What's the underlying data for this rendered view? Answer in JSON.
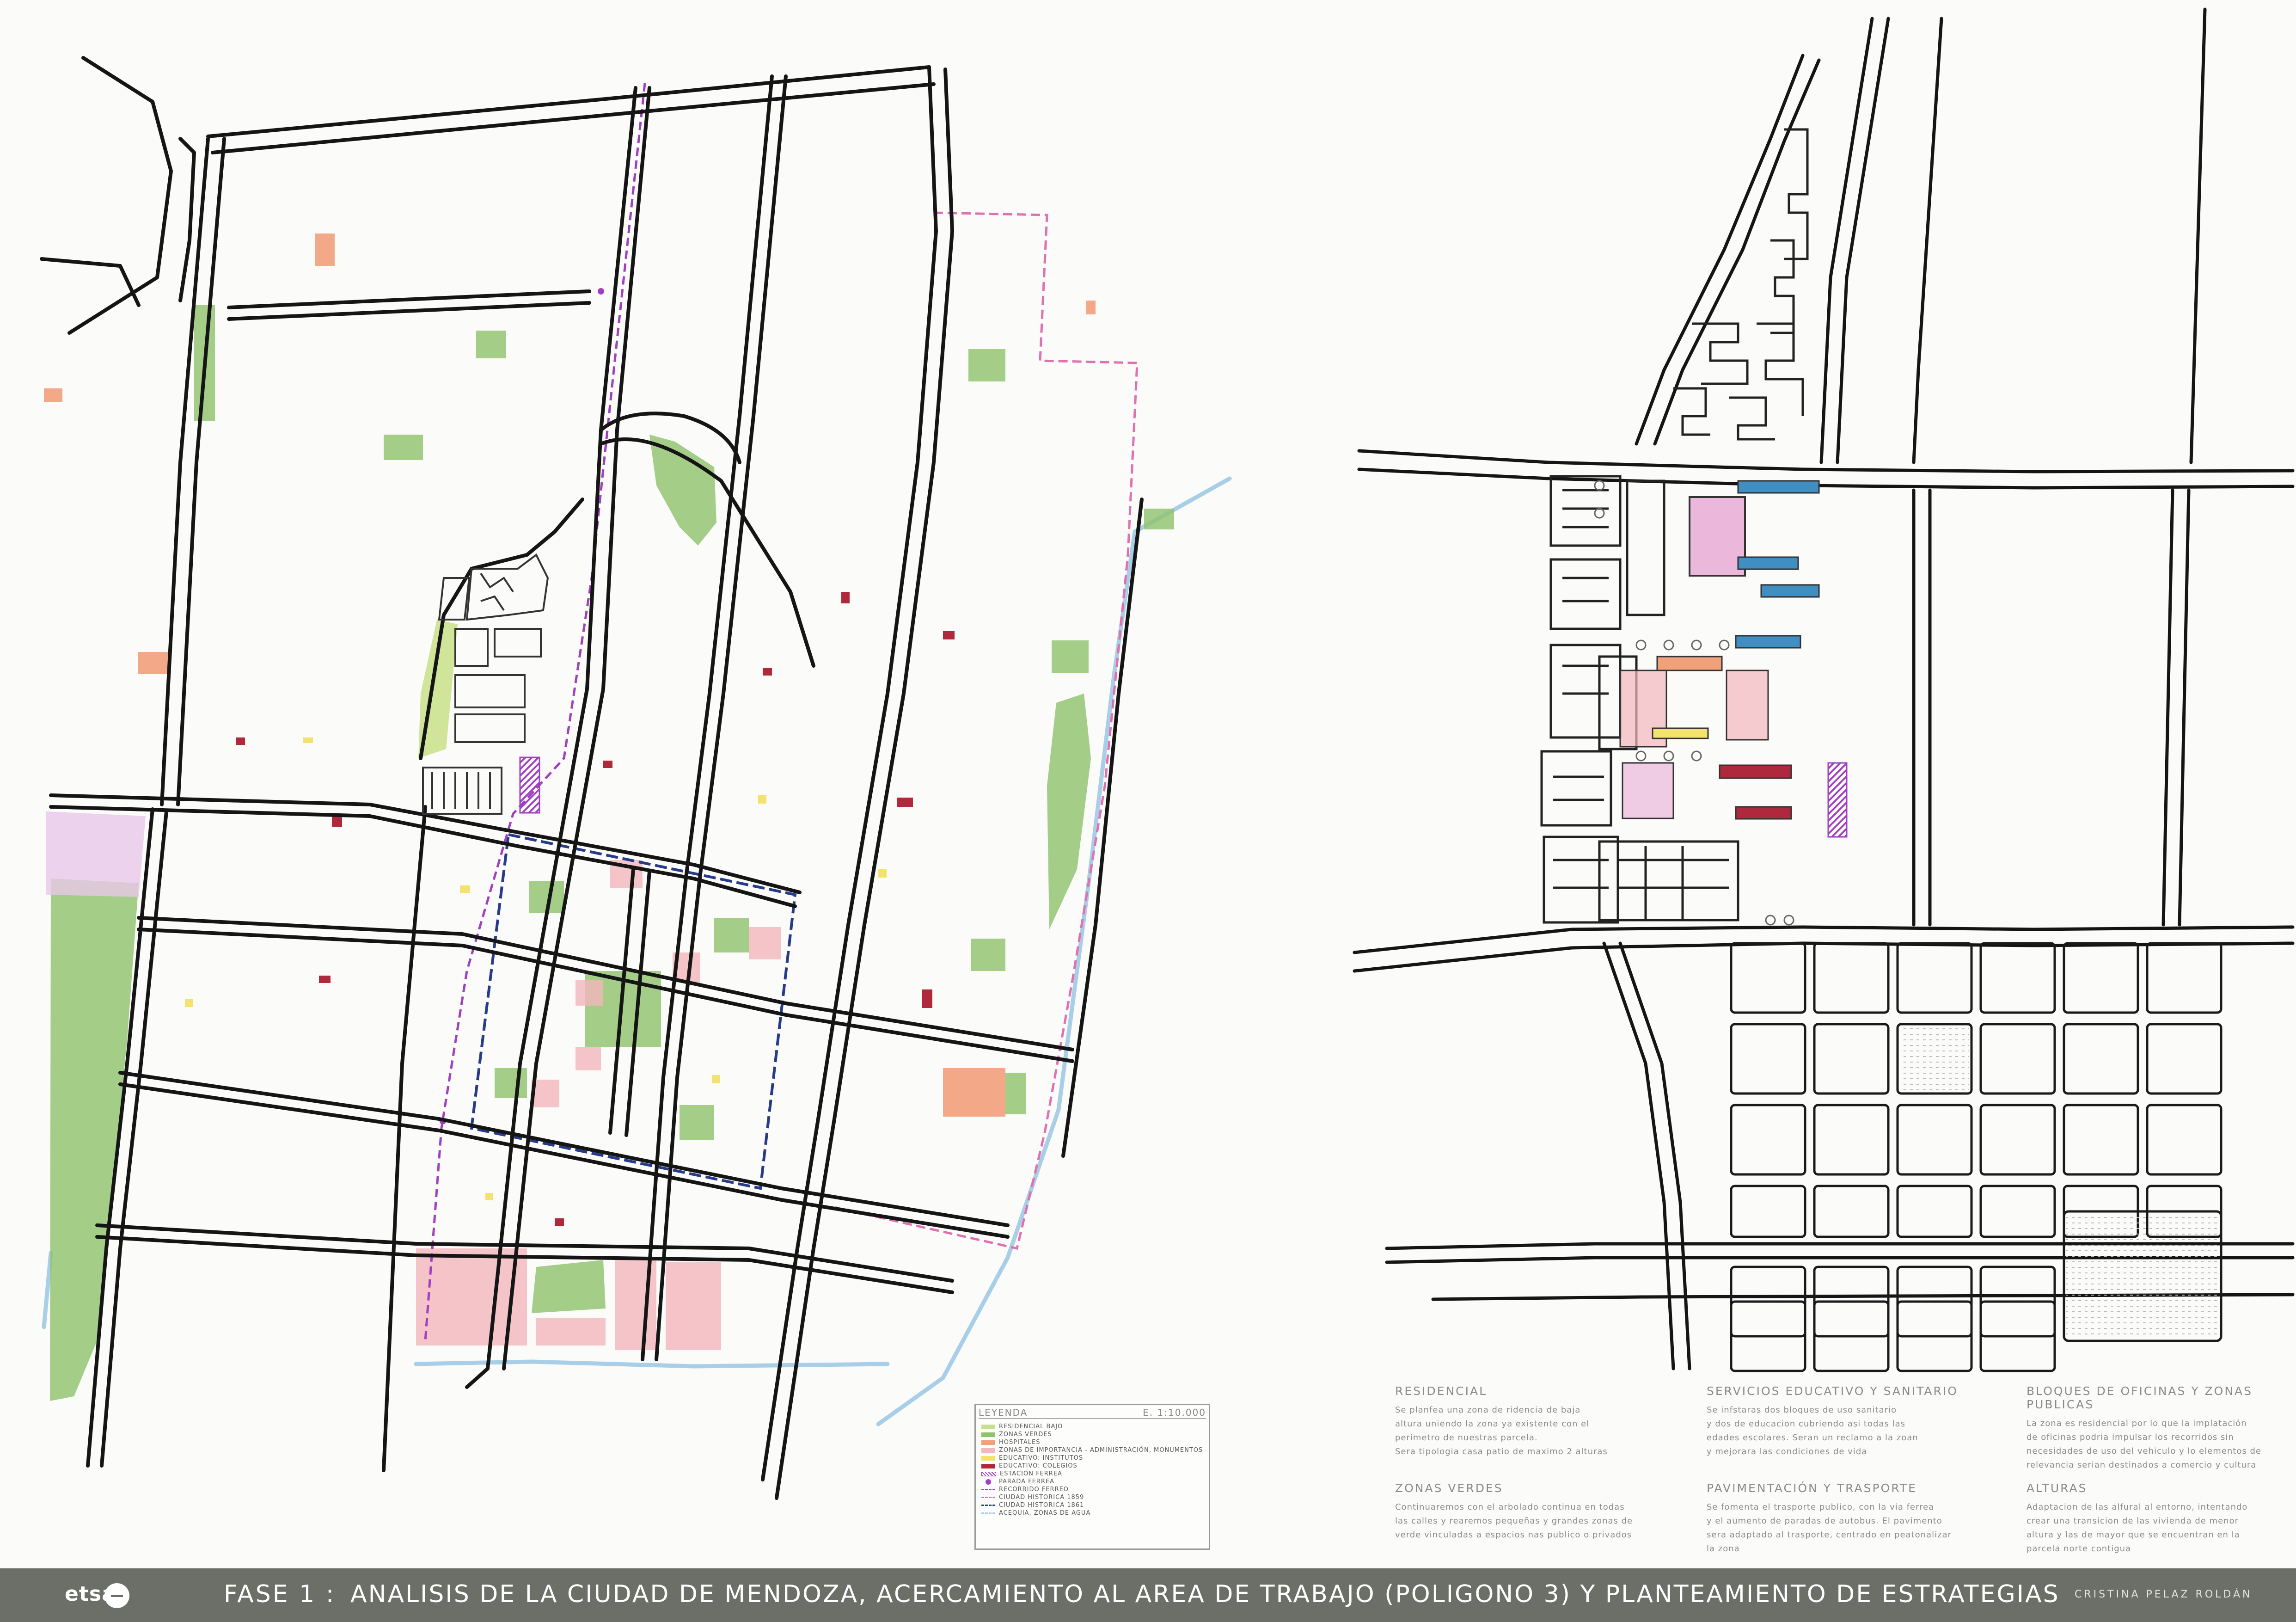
{
  "colors": {
    "residential": "#c9e08a",
    "green": "#8ec26c",
    "hospital": "#f2a07a",
    "monument": "#f4b7bd",
    "institute": "#f3e36e",
    "school": "#b0283c",
    "rail": "#a040c0",
    "historic1859": "#e070b0",
    "historic1861": "#263c8a",
    "water": "#a9cfe8",
    "office": "#3f8fc2"
  },
  "legend": {
    "title": "LEYENDA",
    "scale": "E. 1:10.000",
    "items": [
      {
        "label": "RESIDENCIAL BAJO",
        "kind": "box",
        "color": "#c9e08a"
      },
      {
        "label": "ZONAS VERDES",
        "kind": "box",
        "color": "#8ec26c"
      },
      {
        "label": "HOSPITALES",
        "kind": "box",
        "color": "#f2a07a"
      },
      {
        "label": "ZONAS DE IMPORTANCIA - ADMINISTRACIÓN, MONUMENTOS",
        "kind": "box",
        "color": "#f4b7bd"
      },
      {
        "label": "EDUCATIVO: INSTITUTOS",
        "kind": "box",
        "color": "#f3e36e"
      },
      {
        "label": "EDUCATIVO: COLEGIOS",
        "kind": "box",
        "color": "#b0283c"
      },
      {
        "label": "ESTACIÓN FERREA",
        "kind": "hatch",
        "color": "#a040c0"
      },
      {
        "label": "PARADA FERREA",
        "kind": "dot",
        "color": "#a040c0"
      },
      {
        "label": "RECORRIDO FERREO",
        "kind": "line",
        "color": "#a040c0"
      },
      {
        "label": "CIUDAD HISTORICA 1859",
        "kind": "line",
        "color": "#e070b0"
      },
      {
        "label": "CIUDAD HISTORICA 1861",
        "kind": "line",
        "color": "#263c8a"
      },
      {
        "label": "ACEQUIA, ZONAS DE AGUA",
        "kind": "line",
        "color": "#a9cfe8"
      }
    ]
  },
  "sections": [
    {
      "title": "RESIDENCIAL",
      "body": "Se planfea una zona de ridencia de baja\naltura uniendo la zona ya existente con el\nperimetro de nuestras parcela.\nSera tipologia casa patio de maximo 2 alturas"
    },
    {
      "title": "SERVICIOS EDUCATIVO Y SANITARIO",
      "body": "Se infstaras dos bloques de uso sanitario\ny dos de educacion cubriendo asi todas las\nedades escolares. Seran un reclamo a la zoan\ny mejorara las condiciones de vida"
    },
    {
      "title": "BLOQUES DE OFICINAS Y ZONAS PUBLICAS",
      "body": "La zona es residencial por lo que la implatación\nde oficinas podria impulsar los recorridos sin\nnecesidades de uso del vehiculo y lo elementos de\nrelevancia serian destinados a comercio y cultura"
    },
    {
      "title": "ZONAS VERDES",
      "body": "Continuaremos con el arbolado continua en todas\nlas calles y rearemos pequeñas y grandes zonas de\nverde vinculadas a espacios nas publico o privados"
    },
    {
      "title": "PAVIMENTACIÓN Y TRASPORTE",
      "body": "Se fomenta el trasporte publico, con la via ferrea\ny el aumento de paradas de autobus. El pavimento\nsera adaptado al trasporte, centrado en peatonalizar\nla zona"
    },
    {
      "title": "ALTURAS",
      "body": "Adaptacion de las alfural al entorno, intentando\ncrear una transicion de las vivienda de menor\naltura y las de mayor que se encuentran en la\nparcela norte contigua"
    }
  ],
  "footer": {
    "logo": "etsa",
    "phase": "FASE 1 :",
    "title": "ANALISIS DE LA CIUDAD DE MENDOZA, ACERCAMIENTO AL AREA DE TRABAJO (POLIGONO 3) Y PLANTEAMIENTO DE ESTRATEGIAS",
    "author": "CRISTINA  PELAZ  ROLDÁN"
  }
}
